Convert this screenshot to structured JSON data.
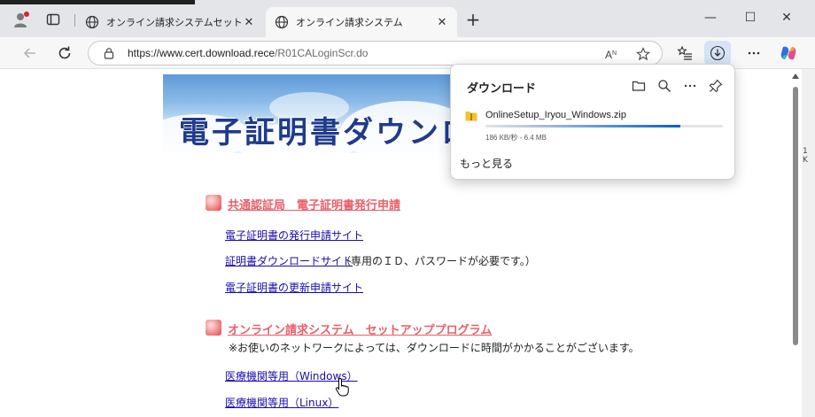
{
  "tabs": [
    {
      "title": "オンライン請求システムセットアップ手順",
      "close": "✕"
    },
    {
      "title": "オンライン請求システム",
      "close": "✕"
    }
  ],
  "new_tab": "+",
  "window_controls": {
    "minimize": "—",
    "maximize": "☐",
    "close": "✕"
  },
  "address": {
    "host": "https://www.cert.download.rece",
    "path": "/R01CALoginScr.do"
  },
  "colors": {
    "accent": "#0a5fd0",
    "section_title": "#e8606a",
    "link": "#1a0dab"
  },
  "page": {
    "banner_title": "電子証明書ダウンロード",
    "sections": [
      {
        "title": "共通認証局　電子証明書発行申請",
        "links": [
          {
            "label": "電子証明書の発行申請サイト",
            "note": ""
          },
          {
            "label": "証明書ダウンロードサイト",
            "note": "（専用のＩＤ、パスワードが必要です。）"
          },
          {
            "label": "電子証明書の更新申請サイト",
            "note": ""
          }
        ]
      },
      {
        "title": "オンライン請求システム　セットアッププログラム",
        "note": "※お使いのネットワークによっては、ダウンロードに時間がかかることがございます。",
        "links": [
          {
            "label": "医療機関等用（Windows）",
            "note": ""
          },
          {
            "label": "医療機関等用（Linux）",
            "note": ""
          }
        ]
      }
    ],
    "right_edge_fragment": "1 K"
  },
  "downloads": {
    "title": "ダウンロード",
    "file_name": "OnlineSetup_Iryou_Windows.zip",
    "status": "186 KB/秒 - 6.4 MB",
    "progress": 0.82,
    "see_more": "もっと見る"
  }
}
